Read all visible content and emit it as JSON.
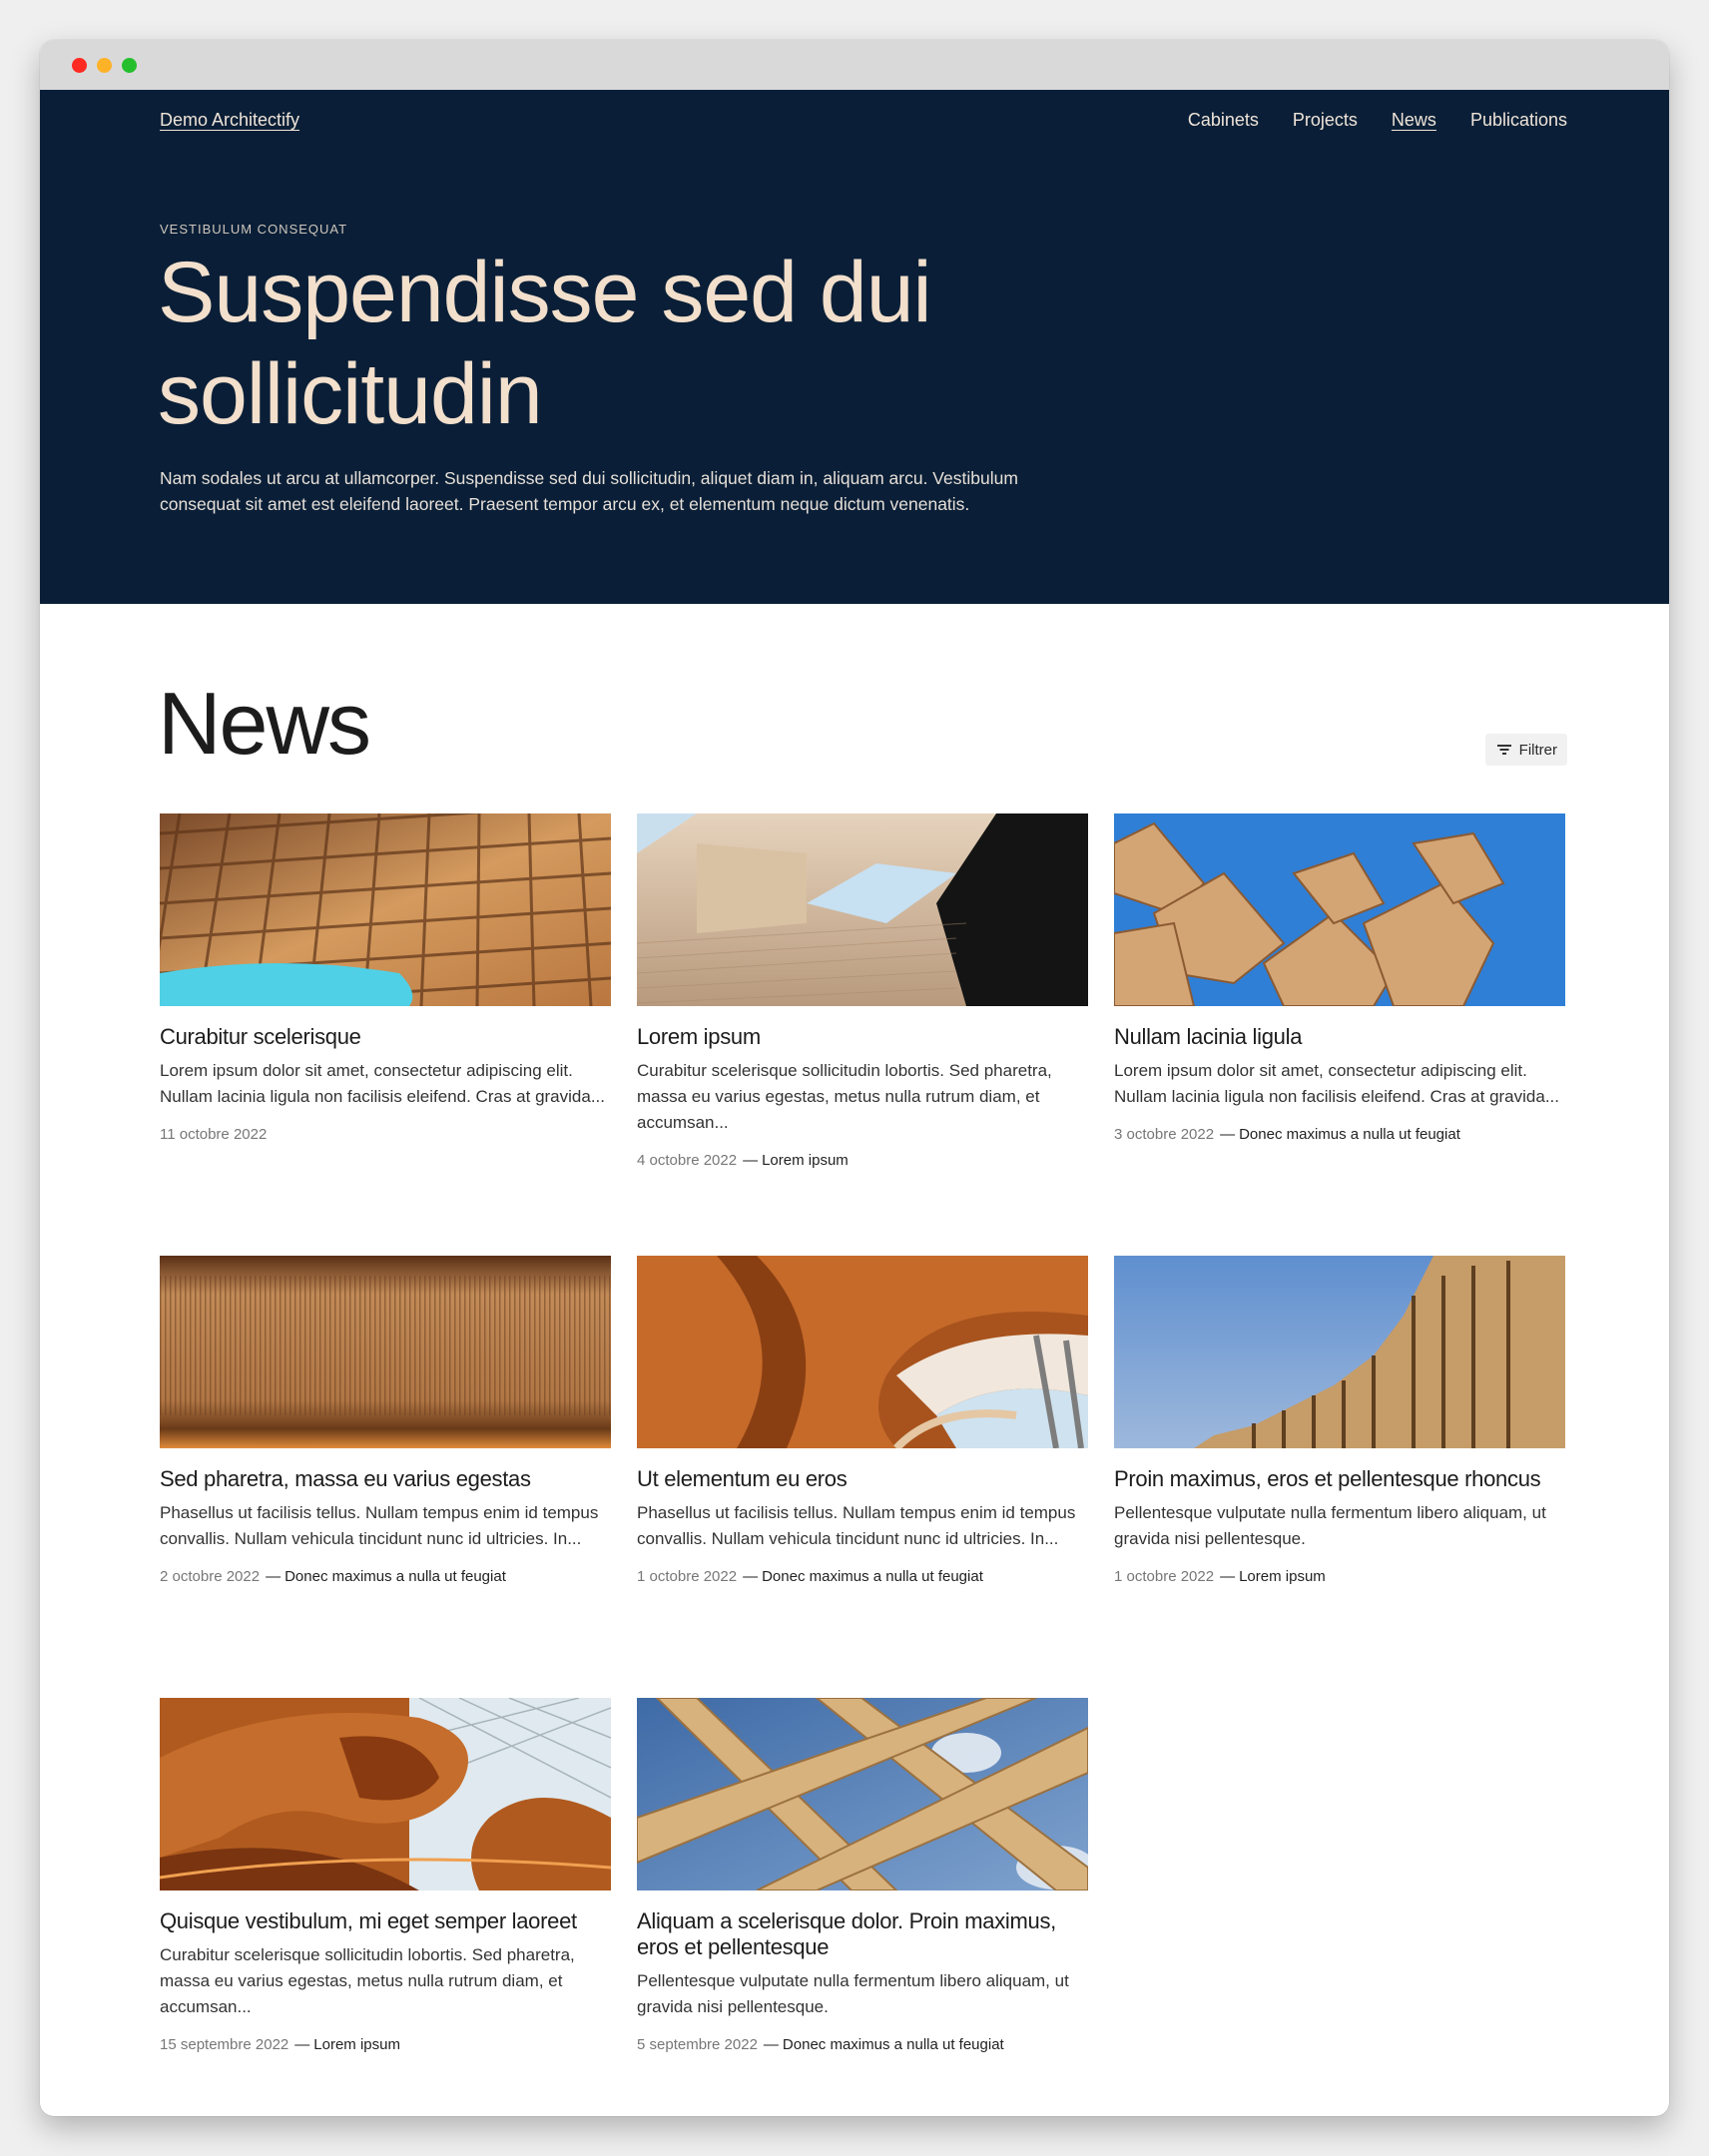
{
  "header": {
    "brand": "Demo Architectify",
    "nav": [
      {
        "label": "Cabinets",
        "active": false
      },
      {
        "label": "Projects",
        "active": false
      },
      {
        "label": "News",
        "active": true
      },
      {
        "label": "Publications",
        "active": false
      }
    ]
  },
  "hero": {
    "eyebrow": "VESTIBULUM CONSEQUAT",
    "title": "Suspendisse sed dui sollicitudin",
    "text": "Nam sodales ut arcu at ullamcorper. Suspendisse sed dui sollicitudin, aliquet diam in, aliquam arcu. Vestibulum consequat sit amet est eleifend laoreet. Praesent tempor arcu ex, et elementum neque dictum venenatis."
  },
  "news": {
    "title": "News",
    "filter_label": "Filtrer",
    "items": [
      {
        "title": "Curabitur scelerisque",
        "excerpt": "Lorem ipsum dolor sit amet, consectetur adipiscing elit. Nullam lacinia ligula non facilisis eleifend. Cras at gravida...",
        "date": "11 octobre 2022",
        "category": "",
        "image": "wooden-lattice-canopy-photo"
      },
      {
        "title": "Lorem ipsum",
        "excerpt": "Curabitur scelerisque sollicitudin lobortis. Sed pharetra, massa eu varius egestas, metus nulla rutrum diam, et accumsan...",
        "date": "4 octobre 2022",
        "category": "Lorem ipsum",
        "image": "timber-facade-skylight-photo"
      },
      {
        "title": "Nullam lacinia ligula",
        "excerpt": "Lorem ipsum dolor sit amet, consectetur adipiscing elit. Nullam lacinia ligula non facilisis eleifend. Cras at gravida...",
        "date": "3 octobre 2022",
        "category": "Donec maximus a nulla ut feugiat",
        "image": "stacked-timber-beams-sky-photo"
      },
      {
        "title": "Sed pharetra, massa eu varius egestas",
        "excerpt": "Phasellus ut facilisis tellus. Nullam tempus enim id tempus convallis. Nullam vehicula tincidunt nunc id ultricies. In...",
        "date": "2 octobre 2022",
        "category": "Donec maximus a nulla ut feugiat",
        "image": "wooden-slat-ceiling-photo"
      },
      {
        "title": "Ut elementum eu eros",
        "excerpt": "Phasellus ut facilisis tellus. Nullam tempus enim id tempus convallis. Nullam vehicula tincidunt nunc id ultricies. In...",
        "date": "1 octobre 2022",
        "category": "Donec maximus a nulla ut feugiat",
        "image": "curved-wood-interior-photo"
      },
      {
        "title": "Proin maximus, eros et pellentesque rhoncus",
        "excerpt": "Pellentesque vulputate nulla fermentum libero aliquam, ut gravida nisi pellentesque.",
        "date": "1 octobre 2022",
        "category": "Lorem ipsum",
        "image": "timber-frames-blue-sky-photo"
      },
      {
        "title": "Quisque vestibulum, mi eget semper laoreet",
        "excerpt": "Curabitur scelerisque sollicitudin lobortis. Sed pharetra, massa eu varius egestas, metus nulla rutrum diam, et accumsan...",
        "date": "15 septembre 2022",
        "category": "Lorem ipsum",
        "image": "wooden-spiral-atrium-photo"
      },
      {
        "title": "Aliquam a scelerisque dolor. Proin maximus, eros et pellentesque",
        "excerpt": "Pellentesque vulputate nulla fermentum libero aliquam, ut gravida nisi pellentesque.",
        "date": "5 septembre 2022",
        "category": "Donec maximus a nulla ut feugiat",
        "image": "crossed-wood-beams-sky-photo"
      }
    ]
  },
  "colors": {
    "hero_bg": "#0a1f37",
    "hero_title": "#f2dfcc",
    "page_bg": "#ffffff"
  }
}
